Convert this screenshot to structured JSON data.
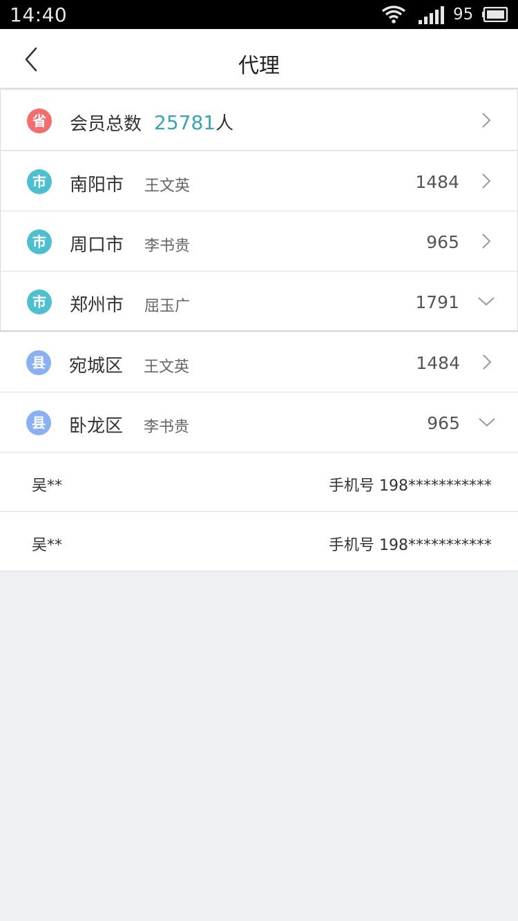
{
  "status_bar": {
    "time": "14:40",
    "battery_level": "95"
  },
  "nav": {
    "title": "代理"
  },
  "summary": {
    "badge": "省",
    "label": "会员总数",
    "count": "25781",
    "unit": "人"
  },
  "regions": [
    {
      "badge": "市",
      "name": "南阳市",
      "person": "王文英",
      "count": "1484",
      "expanded": false
    },
    {
      "badge": "市",
      "name": "周口市",
      "person": "李书贵",
      "count": "965",
      "expanded": false
    },
    {
      "badge": "市",
      "name": "郑州市",
      "person": "屈玉广",
      "count": "1791",
      "expanded": true
    },
    {
      "badge": "县",
      "name": "宛城区",
      "person": "王文英",
      "count": "1484",
      "expanded": false
    },
    {
      "badge": "县",
      "name": "卧龙区",
      "person": "李书贵",
      "count": "965",
      "expanded": true
    }
  ],
  "members": [
    {
      "name": "吴**",
      "phone": "手机号 198***********"
    },
    {
      "name": "吴**",
      "phone": "手机号 198***********"
    }
  ],
  "colors": {
    "province_badge": "#f26d6d",
    "city_badge": "#4ebfcf",
    "county_badge": "#8ab0f1",
    "accent": "#3aa3b0",
    "background": "#eff0f4"
  }
}
